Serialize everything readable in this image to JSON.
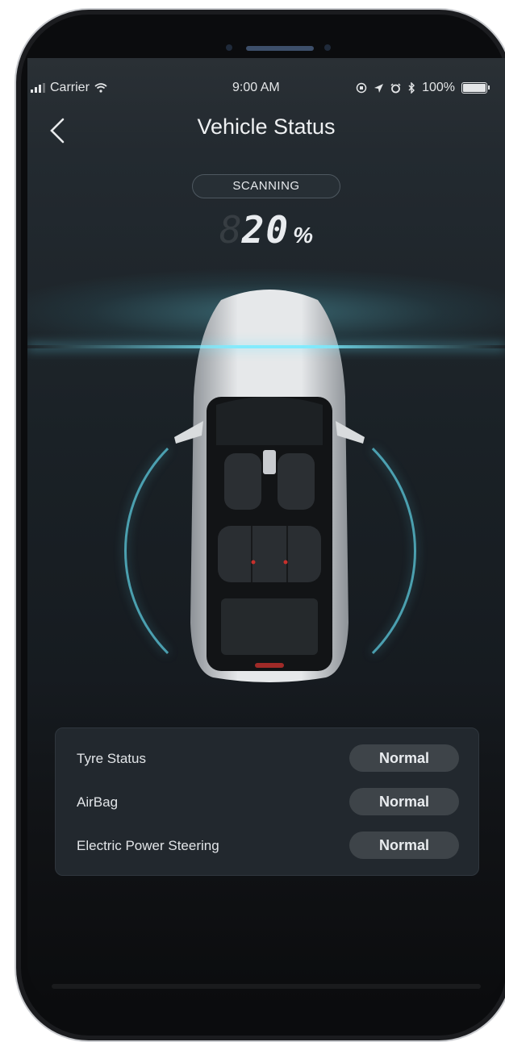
{
  "status_bar": {
    "carrier": "Carrier",
    "time": "9:00 AM",
    "battery": "100%"
  },
  "nav": {
    "title": "Vehicle Status"
  },
  "scan": {
    "label": "SCANNING",
    "ghost_digit": "8",
    "value": "20",
    "unit": "%",
    "progress": 0.2
  },
  "checks": [
    {
      "label": "Tyre Status",
      "status": "Normal"
    },
    {
      "label": "AirBag",
      "status": "Normal"
    },
    {
      "label": "Electric Power Steering",
      "status": "Normal"
    }
  ],
  "colors": {
    "accent": "#6fe0f2",
    "background": "#1a2126",
    "card": "#22282e",
    "badge": "#3e4449"
  },
  "icons": [
    "signal-icon",
    "wifi-icon",
    "orientation-lock-icon",
    "location-icon",
    "alarm-icon",
    "bluetooth-icon",
    "battery-icon",
    "back-chevron-icon"
  ]
}
